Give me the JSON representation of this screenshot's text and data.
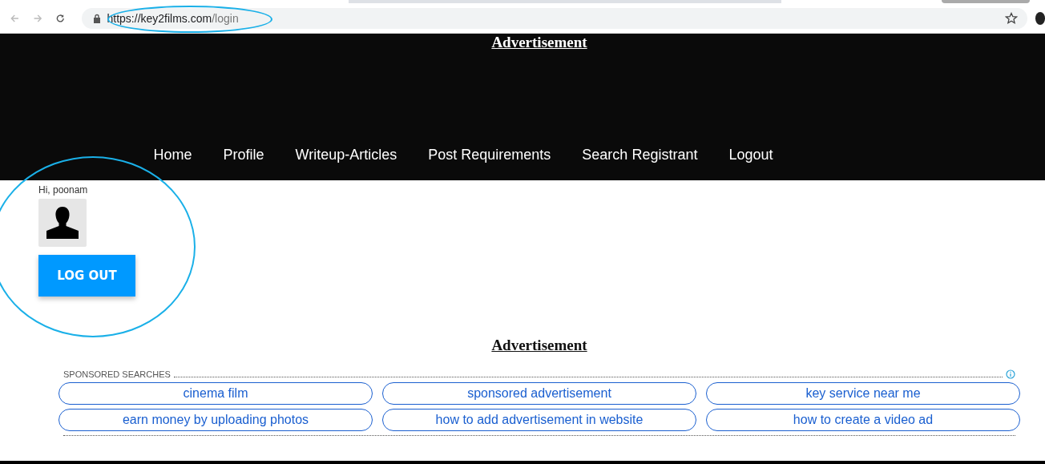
{
  "browser": {
    "url_host": "https://key2films.com",
    "url_path": "/login"
  },
  "header": {
    "ad_label": "Advertisement",
    "nav": [
      {
        "label": "Home"
      },
      {
        "label": "Profile"
      },
      {
        "label": "Writeup-Articles"
      },
      {
        "label": "Post Requirements"
      },
      {
        "label": "Search Registrant"
      },
      {
        "label": "Logout"
      }
    ]
  },
  "user": {
    "greeting": "Hi, poonam",
    "logout_button": "LOG OUT"
  },
  "ad_label": "Advertisement",
  "sponsored": {
    "heading": "SPONSORED SEARCHES",
    "links": [
      "cinema film",
      "sponsored advertisement",
      "key service near me",
      "earn money by uploading photos",
      "how to add advertisement in website",
      "how to create a video ad"
    ]
  },
  "annotations": [
    {
      "kind": "ellipse"
    },
    {
      "kind": "ellipse"
    }
  ]
}
